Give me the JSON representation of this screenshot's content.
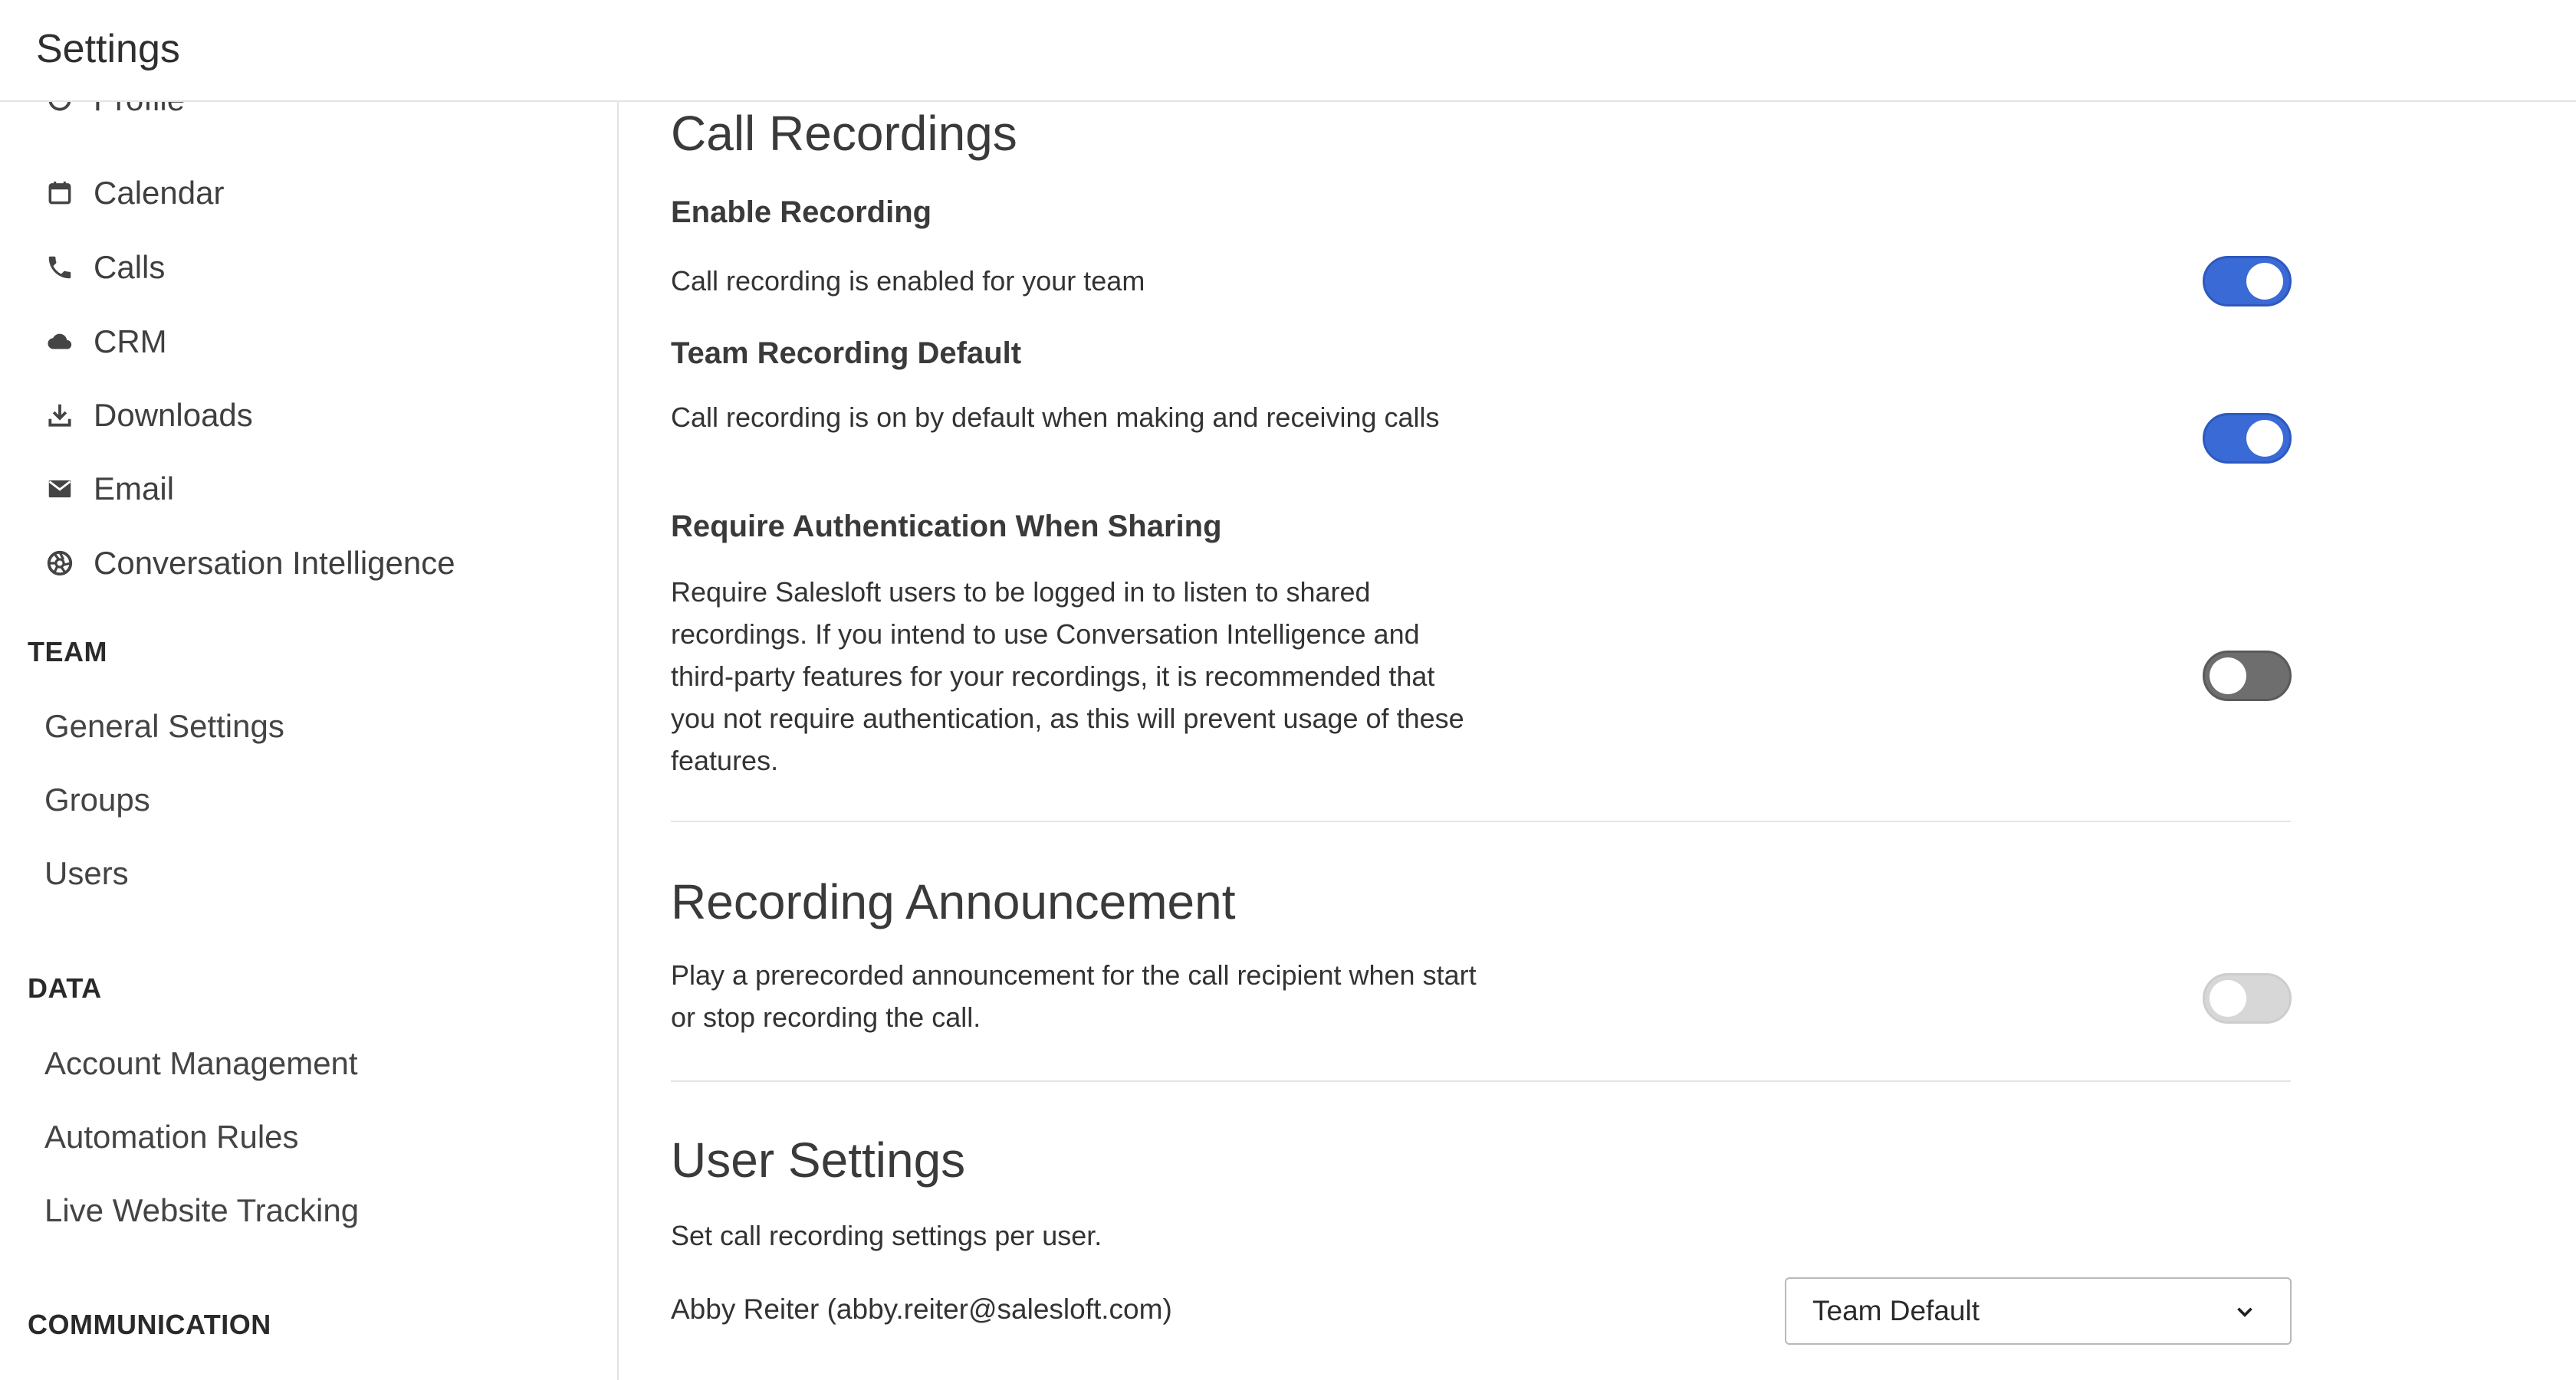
{
  "header": {
    "title": "Settings"
  },
  "sidebar": {
    "personal_items": [
      {
        "label": "Profile",
        "icon": "profile-icon"
      },
      {
        "label": "Calendar",
        "icon": "calendar-icon"
      },
      {
        "label": "Calls",
        "icon": "phone-icon"
      },
      {
        "label": "CRM",
        "icon": "cloud-icon"
      },
      {
        "label": "Downloads",
        "icon": "download-icon"
      },
      {
        "label": "Email",
        "icon": "envelope-icon"
      },
      {
        "label": "Conversation Intelligence",
        "icon": "aperture-icon"
      }
    ],
    "team": {
      "heading": "TEAM",
      "items": [
        "General Settings",
        "Groups",
        "Users"
      ]
    },
    "data": {
      "heading": "DATA",
      "items": [
        "Account Management",
        "Automation Rules",
        "Live Website Tracking"
      ]
    },
    "communication": {
      "heading": "COMMUNICATION"
    }
  },
  "main": {
    "call_recordings": {
      "title": "Call Recordings",
      "enable": {
        "heading": "Enable Recording",
        "description": "Call recording is enabled for your team",
        "enabled": true
      },
      "team_default": {
        "heading": "Team Recording Default",
        "description": "Call recording is on by default when making and receiving calls",
        "enabled": true
      },
      "require_auth": {
        "heading": "Require Authentication When Sharing",
        "description": "Require Salesloft users to be logged in to listen to shared recordings. If you intend to use Conversation Intelligence and third-party features for your recordings, it is recommended that you not require authentication, as this will prevent usage of these features.",
        "enabled": false
      }
    },
    "recording_announcement": {
      "title": "Recording Announcement",
      "description": "Play a prerecorded announcement for the call recipient when start or stop recording the call.",
      "enabled": false,
      "disabled": true
    },
    "user_settings": {
      "title": "User Settings",
      "description": "Set call recording settings per user.",
      "users": [
        {
          "name": "Abby Reiter (abby.reiter@salesloft.com)",
          "setting": "Team Default"
        }
      ]
    }
  },
  "colors": {
    "toggle_on": "#3a6ad6",
    "toggle_off_dark": "#6e6e6e",
    "toggle_off_light": "#d7d7d7",
    "divider": "#e4e4e4"
  }
}
